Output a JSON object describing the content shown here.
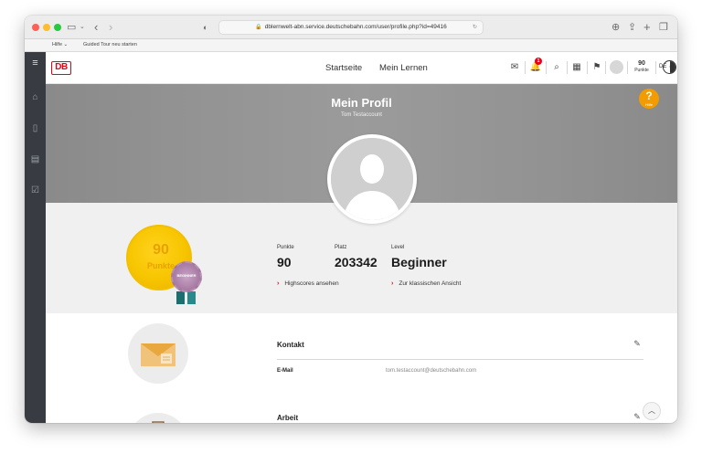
{
  "browser": {
    "url": "dblernwelt-abn.service.deutschebahn.com/user/profile.php?id=49416",
    "bookmarks": [
      "Hilfe",
      "Guided Tour neu starten"
    ]
  },
  "nav": {
    "logo": "DB",
    "links": [
      "Startseite",
      "Mein Lernen"
    ],
    "notification_count": "1",
    "points_value": "90",
    "points_label": "Punkte",
    "language": "DE"
  },
  "hero": {
    "title": "Mein Profil",
    "subtitle": "Tom Testaccount",
    "help_label": "?",
    "help_sub": "Hilfe"
  },
  "stats": {
    "coin_value": "90",
    "coin_label": "Punkte",
    "medal_text": "BEGINNER",
    "points_label": "Punkte",
    "points_value": "90",
    "rank_label": "Platz",
    "rank_value": "203342",
    "level_label": "Level",
    "level_value": "Beginner",
    "link_highscores": "Highscores ansehen",
    "link_classic": "Zur klassischen Ansicht"
  },
  "contact": {
    "title": "Kontakt",
    "email_label": "E-Mail",
    "email_value": "tom.testaccount@deutschebahn.com"
  },
  "work": {
    "title": "Arbeit"
  },
  "colors": {
    "db_red": "#ec0016",
    "coin_gold": "#f7c500",
    "help_orange": "#f29c00",
    "rail_dark": "#383b42"
  }
}
